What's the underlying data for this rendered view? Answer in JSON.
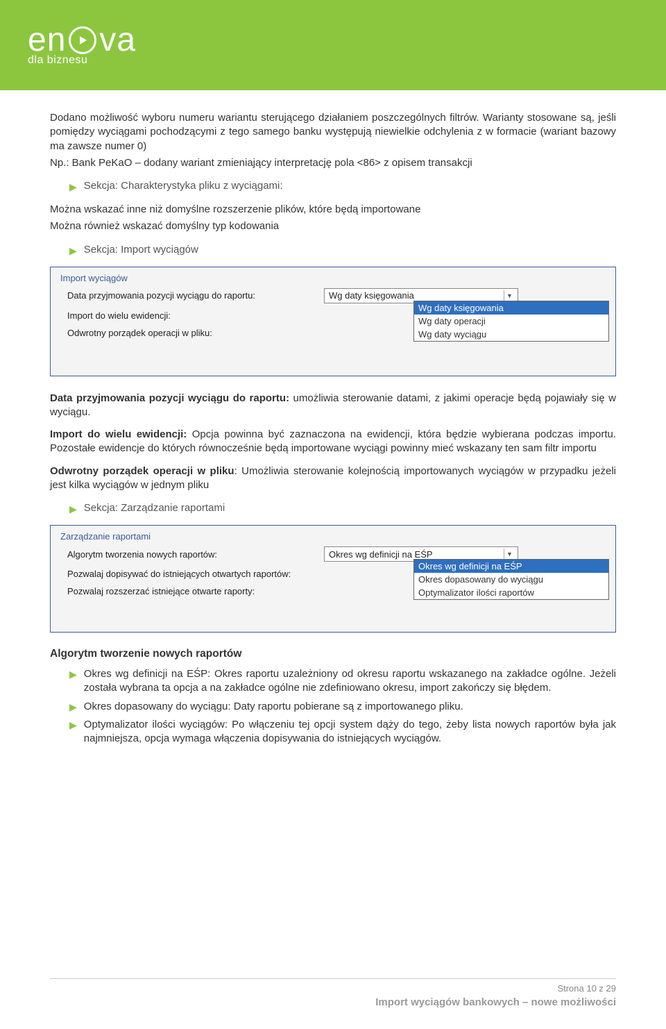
{
  "logo": {
    "brand_pre": "en",
    "brand_post": "va",
    "tagline": "dla biznesu"
  },
  "p1": "Dodano możliwość wyboru numeru wariantu sterującego działaniem poszczególnych filtrów. Warianty stosowane są, jeśli pomiędzy wyciągami pochodzącymi z tego samego banku występują niewielkie odchylenia z w formacie (wariant bazowy ma zawsze numer 0)",
  "p2": "Np.: Bank PeKaO – dodany wariant zmieniający interpretację pola <86> z opisem transakcji",
  "bullet1": "Sekcja: Charakterystyka pliku z wyciągami:",
  "p3": "Można wskazać inne niż domyślne rozszerzenie plików, które będą importowane",
  "p4": "Można również wskazać domyślny typ kodowania",
  "bullet2": "Sekcja: Import wyciągów",
  "panel1": {
    "title": "Import wyciągów",
    "row1_label": "Data przyjmowania pozycji wyciągu do raportu:",
    "row1_value": "Wg daty księgowania",
    "row2_label": "Import do wielu ewidencji:",
    "row3_label": "Odwrotny porządek operacji w pliku:",
    "options": [
      "Wg daty księgowania",
      "Wg daty operacji",
      "Wg daty wyciągu"
    ]
  },
  "p5a": "Data przyjmowania pozycji wyciągu do raportu:",
  "p5b": " umożliwia sterowanie datami, z jakimi operacje będą pojawiały się w wyciągu.",
  "p6a": "Import do wielu ewidencji:",
  "p6b": " Opcja powinna być zaznaczona na ewidencji, która będzie wybierana podczas importu. Pozostałe ewidencje do których równocześnie będą importowane wyciągi powinny mieć wskazany ten sam filtr importu",
  "p7a": "Odwrotny porządek operacji w pliku",
  "p7b": ": Umożliwia sterowanie kolejnością importowanych wyciągów w przypadku jeżeli jest kilka wyciągów w jednym pliku",
  "bullet3": "Sekcja: Zarządzanie raportami",
  "panel2": {
    "title": "Zarządzanie raportami",
    "row1_label": "Algorytm tworzenia nowych raportów:",
    "row1_value": "Okres wg definicji na EŚP",
    "row2_label": "Pozwalaj dopisywać do istniejących otwartych raportów:",
    "row3_label": "Pozwalaj rozszerzać istniejące otwarte raporty:",
    "options": [
      "Okres wg definicji na EŚP",
      "Okres dopasowany do wyciągu",
      "Optymalizator ilości raportów"
    ]
  },
  "h2": "Algorytm tworzenie nowych raportów",
  "li1a": "Okres wg definicji na EŚP",
  "li1b": ": Okres raportu uzależniony od okresu raportu wskazanego na zakładce ogólne. Jeżeli została wybrana ta opcja a na zakładce ogólne nie zdefiniowano okresu, import zakończy się błędem.",
  "li2a": "Okres dopasowany do wyciągu",
  "li2b": ": Daty raportu pobierane są z importowanego pliku.",
  "li3a": "Optymalizator ilości wyciągów: ",
  "li3b": "Po włączeniu tej opcji system dąży do tego, żeby lista nowych raportów była jak najmniejsza, opcja wymaga włączenia dopisywania do istniejących wyciągów.",
  "footer": {
    "page": "Strona 10 z 29",
    "title": "Import wyciągów bankowych – nowe możliwości"
  }
}
